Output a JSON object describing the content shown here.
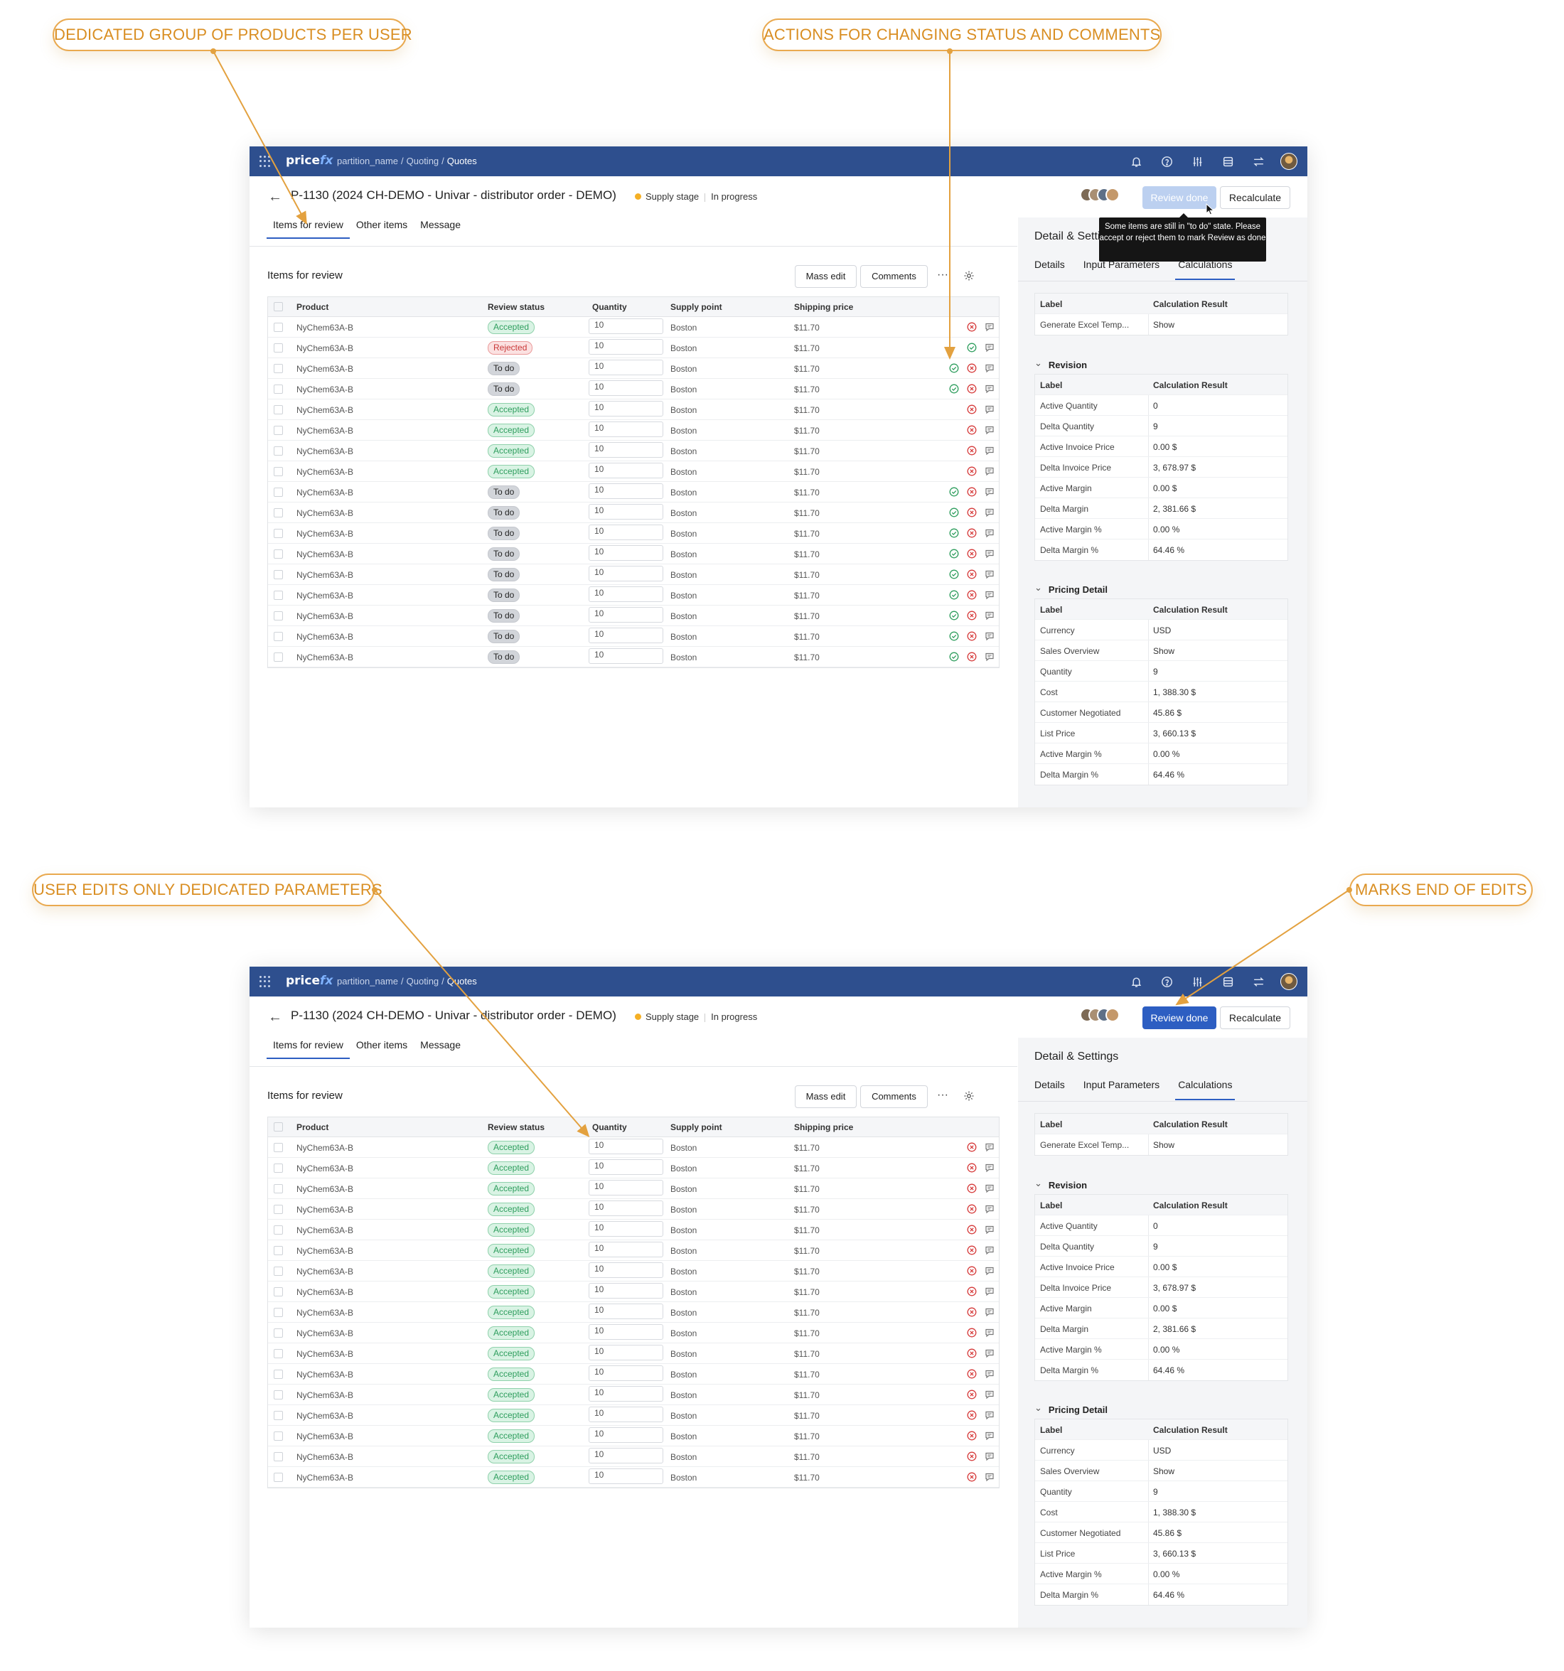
{
  "callouts": {
    "c1": "DEDICATED GROUP OF PRODUCTS PER USER",
    "c2": "ACTIONS FOR CHANGING STATUS AND COMMENTS",
    "c3": "USER EDITS ONLY DEDICATED PARAMETERS",
    "c4": "MARKS END OF EDITS"
  },
  "colors": {
    "accent": "#2d5ec2",
    "topbar": "#2e4f8e",
    "callout": "#e9a94f",
    "accepted": "#2f9e5e",
    "rejected": "#c93838"
  },
  "app": {
    "logo_main": "price",
    "logo_accent": "fx",
    "breadcrumb": [
      "partition_name",
      "Quoting",
      "Quotes"
    ],
    "topbar_icons": [
      "bell-icon",
      "help-icon",
      "sliders-icon",
      "database-icon",
      "swap-icon"
    ],
    "quote_title": "P-1130 (2024 CH-DEMO - Univar - distributor order - DEMO)",
    "stage": "Supply stage",
    "progress": "In progress",
    "review_done": "Review done",
    "recalculate": "Recalculate",
    "tabs": [
      "Items for review",
      "Other items",
      "Message"
    ],
    "section_title": "Items for review",
    "mass_edit": "Mass edit",
    "comments": "Comments",
    "more": "···",
    "tooltip": "Some items are still in \"to do\" state. Please accept or reject them to mark Review as done",
    "columns": [
      "Product",
      "Review status",
      "Quantity",
      "Supply point",
      "Shipping price"
    ]
  },
  "screen1": {
    "rows": [
      {
        "product": "NyChem63A-B",
        "status": "Accepted",
        "qty": "10",
        "supply": "Boston",
        "price": "$11.70"
      },
      {
        "product": "NyChem63A-B",
        "status": "Rejected",
        "qty": "10",
        "supply": "Boston",
        "price": "$11.70"
      },
      {
        "product": "NyChem63A-B",
        "status": "To do",
        "qty": "10",
        "supply": "Boston",
        "price": "$11.70"
      },
      {
        "product": "NyChem63A-B",
        "status": "To do",
        "qty": "10",
        "supply": "Boston",
        "price": "$11.70"
      },
      {
        "product": "NyChem63A-B",
        "status": "Accepted",
        "qty": "10",
        "supply": "Boston",
        "price": "$11.70"
      },
      {
        "product": "NyChem63A-B",
        "status": "Accepted",
        "qty": "10",
        "supply": "Boston",
        "price": "$11.70"
      },
      {
        "product": "NyChem63A-B",
        "status": "Accepted",
        "qty": "10",
        "supply": "Boston",
        "price": "$11.70"
      },
      {
        "product": "NyChem63A-B",
        "status": "Accepted",
        "qty": "10",
        "supply": "Boston",
        "price": "$11.70"
      },
      {
        "product": "NyChem63A-B",
        "status": "To do",
        "qty": "10",
        "supply": "Boston",
        "price": "$11.70"
      },
      {
        "product": "NyChem63A-B",
        "status": "To do",
        "qty": "10",
        "supply": "Boston",
        "price": "$11.70"
      },
      {
        "product": "NyChem63A-B",
        "status": "To do",
        "qty": "10",
        "supply": "Boston",
        "price": "$11.70"
      },
      {
        "product": "NyChem63A-B",
        "status": "To do",
        "qty": "10",
        "supply": "Boston",
        "price": "$11.70"
      },
      {
        "product": "NyChem63A-B",
        "status": "To do",
        "qty": "10",
        "supply": "Boston",
        "price": "$11.70"
      },
      {
        "product": "NyChem63A-B",
        "status": "To do",
        "qty": "10",
        "supply": "Boston",
        "price": "$11.70"
      },
      {
        "product": "NyChem63A-B",
        "status": "To do",
        "qty": "10",
        "supply": "Boston",
        "price": "$11.70"
      },
      {
        "product": "NyChem63A-B",
        "status": "To do",
        "qty": "10",
        "supply": "Boston",
        "price": "$11.70"
      },
      {
        "product": "NyChem63A-B",
        "status": "To do",
        "qty": "10",
        "supply": "Boston",
        "price": "$11.70"
      }
    ]
  },
  "screen2": {
    "rows": [
      {
        "product": "NyChem63A-B",
        "status": "Accepted",
        "qty": "10",
        "supply": "Boston",
        "price": "$11.70"
      },
      {
        "product": "NyChem63A-B",
        "status": "Accepted",
        "qty": "10",
        "supply": "Boston",
        "price": "$11.70"
      },
      {
        "product": "NyChem63A-B",
        "status": "Accepted",
        "qty": "10",
        "supply": "Boston",
        "price": "$11.70"
      },
      {
        "product": "NyChem63A-B",
        "status": "Accepted",
        "qty": "10",
        "supply": "Boston",
        "price": "$11.70"
      },
      {
        "product": "NyChem63A-B",
        "status": "Accepted",
        "qty": "10",
        "supply": "Boston",
        "price": "$11.70"
      },
      {
        "product": "NyChem63A-B",
        "status": "Accepted",
        "qty": "10",
        "supply": "Boston",
        "price": "$11.70"
      },
      {
        "product": "NyChem63A-B",
        "status": "Accepted",
        "qty": "10",
        "supply": "Boston",
        "price": "$11.70"
      },
      {
        "product": "NyChem63A-B",
        "status": "Accepted",
        "qty": "10",
        "supply": "Boston",
        "price": "$11.70"
      },
      {
        "product": "NyChem63A-B",
        "status": "Accepted",
        "qty": "10",
        "supply": "Boston",
        "price": "$11.70"
      },
      {
        "product": "NyChem63A-B",
        "status": "Accepted",
        "qty": "10",
        "supply": "Boston",
        "price": "$11.70"
      },
      {
        "product": "NyChem63A-B",
        "status": "Accepted",
        "qty": "10",
        "supply": "Boston",
        "price": "$11.70"
      },
      {
        "product": "NyChem63A-B",
        "status": "Accepted",
        "qty": "10",
        "supply": "Boston",
        "price": "$11.70"
      },
      {
        "product": "NyChem63A-B",
        "status": "Accepted",
        "qty": "10",
        "supply": "Boston",
        "price": "$11.70"
      },
      {
        "product": "NyChem63A-B",
        "status": "Accepted",
        "qty": "10",
        "supply": "Boston",
        "price": "$11.70"
      },
      {
        "product": "NyChem63A-B",
        "status": "Accepted",
        "qty": "10",
        "supply": "Boston",
        "price": "$11.70"
      },
      {
        "product": "NyChem63A-B",
        "status": "Accepted",
        "qty": "10",
        "supply": "Boston",
        "price": "$11.70"
      },
      {
        "product": "NyChem63A-B",
        "status": "Accepted",
        "qty": "10",
        "supply": "Boston",
        "price": "$11.70"
      }
    ]
  },
  "side": {
    "title": "Detail & Settings",
    "tabs": [
      "Details",
      "Input Parameters",
      "Calculations"
    ],
    "col_label": "Label",
    "col_result": "Calculation Result",
    "excel_label": "Generate Excel Temp...",
    "show": "Show",
    "revision_title": "Revision",
    "revision": [
      {
        "label": "Active Quantity",
        "value": "0"
      },
      {
        "label": "Delta Quantity",
        "value": "9"
      },
      {
        "label": "Active Invoice Price",
        "value": "0.00 $"
      },
      {
        "label": "Delta Invoice Price",
        "value": "3, 678.97 $"
      },
      {
        "label": "Active Margin",
        "value": "0.00 $"
      },
      {
        "label": "Delta Margin",
        "value": "2, 381.66 $"
      },
      {
        "label": "Active Margin %",
        "value": "0.00 %"
      },
      {
        "label": "Delta Margin %",
        "value": "64.46 %"
      }
    ],
    "pricing_title": "Pricing Detail",
    "pricing": [
      {
        "label": "Currency",
        "value": "USD"
      },
      {
        "label": "Sales Overview",
        "value": "Show"
      },
      {
        "label": "Quantity",
        "value": "9"
      },
      {
        "label": "Cost",
        "value": "1, 388.30 $"
      },
      {
        "label": "Customer Negotiated",
        "value": "45.86 $"
      },
      {
        "label": "List Price",
        "value": "3, 660.13 $"
      },
      {
        "label": "Active Margin %",
        "value": "0.00 %"
      },
      {
        "label": "Delta Margin %",
        "value": "64.46 %"
      }
    ]
  }
}
